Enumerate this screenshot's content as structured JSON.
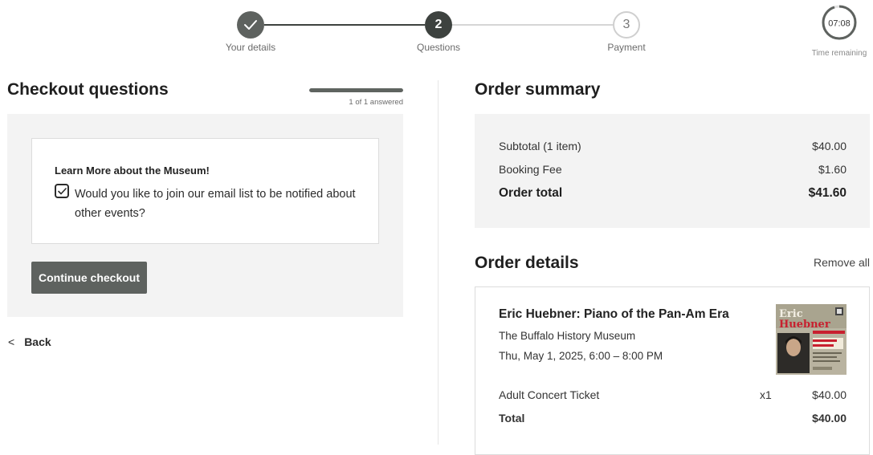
{
  "stepper": {
    "steps": [
      {
        "label": "Your details",
        "number": "",
        "state": "done"
      },
      {
        "label": "Questions",
        "number": "2",
        "state": "current"
      },
      {
        "label": "Payment",
        "number": "3",
        "state": "upcoming"
      }
    ],
    "timer": {
      "value": "07:08",
      "label": "Time remaining",
      "remaining_fraction": 0.95
    }
  },
  "questions": {
    "title": "Checkout questions",
    "progress_text": "1 of 1 answered",
    "progress_fraction": 1.0,
    "heading": "Learn More about the Museum!",
    "checkbox_label": "Would you like to join our email list to be notified about other events?",
    "checked": true,
    "continue_label": "Continue checkout",
    "back_label": "Back"
  },
  "summary": {
    "title": "Order summary",
    "subtotal_label": "Subtotal (1 item)",
    "subtotal_value": "$40.00",
    "fee_label": "Booking Fee",
    "fee_value": "$1.60",
    "total_label": "Order total",
    "total_value": "$41.60"
  },
  "details": {
    "title": "Order details",
    "remove_all": "Remove all",
    "event_title": "Eric Huebner: Piano of the Pan-Am Era",
    "venue": "The Buffalo History Museum",
    "datetime": "Thu, May 1, 2025, 6:00 – 8:00 PM",
    "ticket_label": "Adult Concert Ticket",
    "ticket_qty": "x1",
    "ticket_price": "$40.00",
    "total_label": "Total",
    "total_value": "$40.00",
    "poster": {
      "line1": "Eric",
      "line2": "Huebner"
    }
  },
  "colors": {
    "primary": "#5e625f",
    "step_dark": "#3d423f",
    "panel_bg": "#f3f3f3",
    "poster_red": "#c8202f"
  },
  "icons": [
    "check-icon",
    "chevron-left-icon",
    "timer-ring-icon"
  ]
}
